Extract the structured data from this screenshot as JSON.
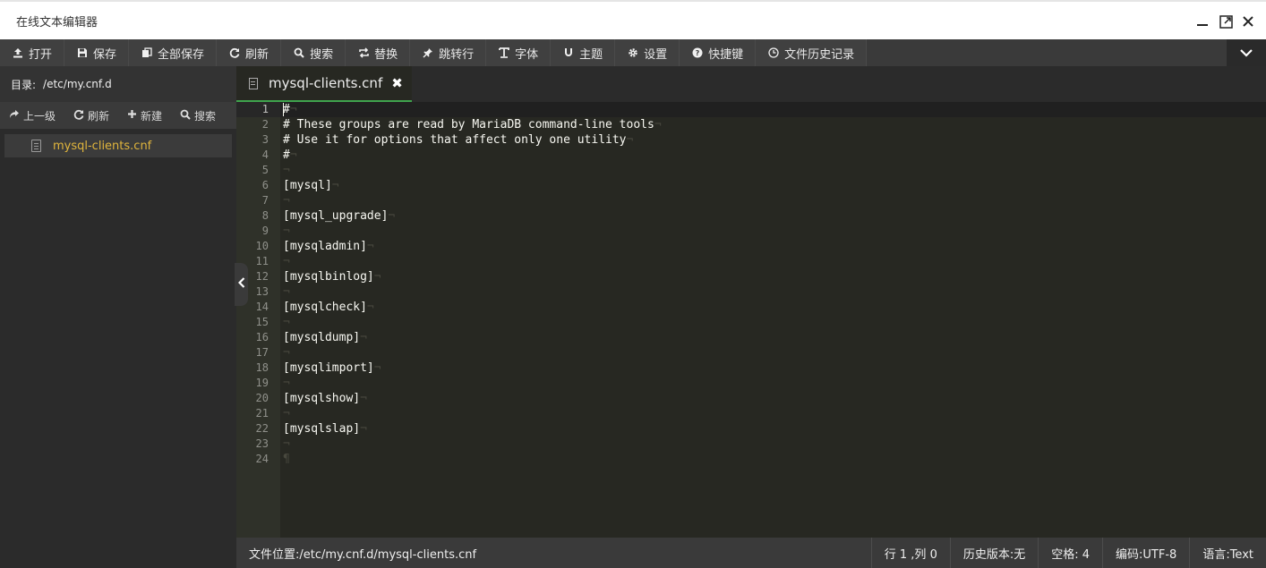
{
  "window": {
    "title": "在线文本编辑器",
    "minimize_icon": "minimize-icon",
    "maximize_icon": "maximize-icon",
    "close_icon": "close-icon"
  },
  "toolbar": {
    "items": [
      {
        "label": "打开",
        "icon": "upload-icon"
      },
      {
        "label": "保存",
        "icon": "save-icon"
      },
      {
        "label": "全部保存",
        "icon": "save-all-icon"
      },
      {
        "label": "刷新",
        "icon": "refresh-icon"
      },
      {
        "label": "搜索",
        "icon": "search-icon"
      },
      {
        "label": "替换",
        "icon": "replace-icon"
      },
      {
        "label": "跳转行",
        "icon": "pin-icon"
      },
      {
        "label": "字体",
        "icon": "text-icon"
      },
      {
        "label": "主题",
        "icon": "magnet-icon"
      },
      {
        "label": "设置",
        "icon": "gear-icon"
      },
      {
        "label": "快捷键",
        "icon": "help-icon"
      },
      {
        "label": "文件历史记录",
        "icon": "clock-icon"
      }
    ],
    "expand_icon": "chevron-down-icon"
  },
  "sidebar": {
    "dir_label": "目录:",
    "dir_path": "/etc/my.cnf.d",
    "actions": [
      {
        "label": "上一级",
        "icon": "share-icon"
      },
      {
        "label": "刷新",
        "icon": "refresh-icon"
      },
      {
        "label": "新建",
        "icon": "plus-icon"
      },
      {
        "label": "搜索",
        "icon": "search-icon"
      }
    ],
    "files": [
      {
        "name": "mysql-clients.cnf",
        "icon": "file-icon"
      }
    ]
  },
  "tabs": [
    {
      "label": "mysql-clients.cnf",
      "icon": "file-icon",
      "close_icon": "close-icon"
    }
  ],
  "editor": {
    "lines": [
      "#",
      "# These groups are read by MariaDB command-line tools",
      "# Use it for options that affect only one utility",
      "#",
      "",
      "[mysql]",
      "",
      "[mysql_upgrade]",
      "",
      "[mysqladmin]",
      "",
      "[mysqlbinlog]",
      "",
      "[mysqlcheck]",
      "",
      "[mysqldump]",
      "",
      "[mysqlimport]",
      "",
      "[mysqlshow]",
      "",
      "[mysqlslap]",
      "",
      ""
    ],
    "eol_marker": "¬",
    "eof_marker": "¶"
  },
  "statusbar": {
    "file_path": "文件位置:/etc/my.cnf.d/mysql-clients.cnf",
    "position": "行 1 ,列 0",
    "history": "历史版本:无",
    "indent": "空格: 4",
    "encoding": "编码:UTF-8",
    "language": "语言:Text"
  }
}
